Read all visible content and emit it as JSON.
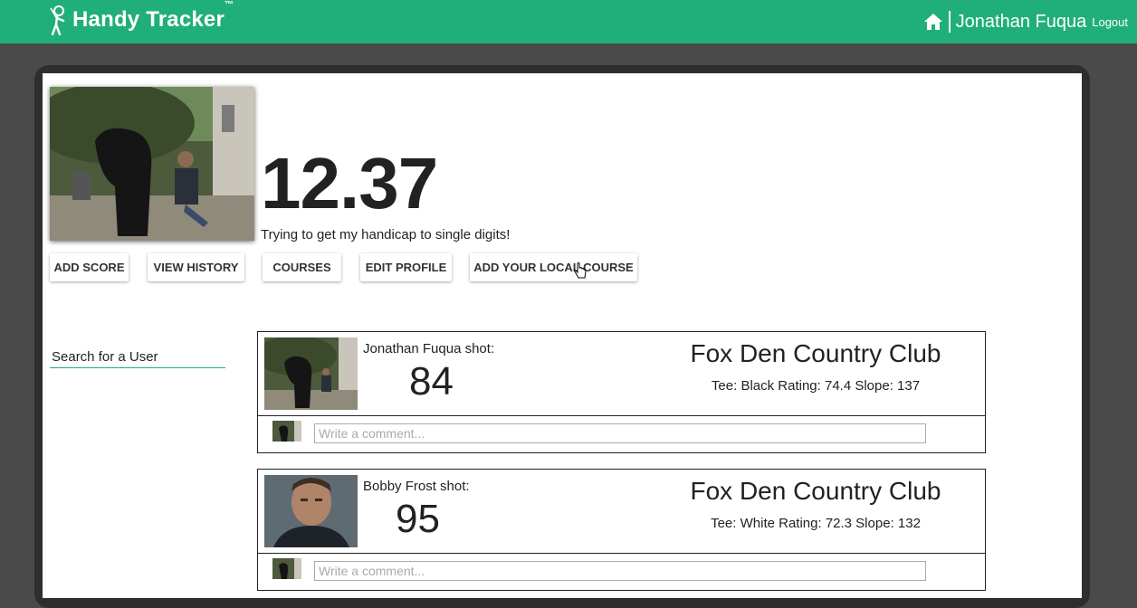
{
  "navbar": {
    "brand": "Handy Tracker",
    "brand_tm": "™",
    "user_name": "Jonathan Fuqua",
    "logout": "Logout",
    "home_icon": "home-icon",
    "logo_icon": "golfer-icon"
  },
  "profile": {
    "handicap": "12.37",
    "bio": "Trying to get my handicap to single digits!"
  },
  "buttons": {
    "add_score": "ADD SCORE",
    "view_history": "VIEW HISTORY",
    "courses": "COURSES",
    "edit_profile": "EDIT PROFILE",
    "add_course": "ADD YOUR LOCAL COURSE"
  },
  "search": {
    "placeholder": "Search for a User"
  },
  "feed": [
    {
      "shot_label": "Jonathan Fuqua shot:",
      "score": "84",
      "course": "Fox Den Country Club",
      "tee_info": "Tee: Black Rating: 74.4 Slope: 137",
      "comment_placeholder": "Write a comment..."
    },
    {
      "shot_label": "Bobby Frost shot:",
      "score": "95",
      "course": "Fox Den Country Club",
      "tee_info": "Tee: White Rating: 72.3 Slope: 132",
      "comment_placeholder": "Write a comment..."
    }
  ],
  "colors": {
    "brand_green": "#20af7a",
    "background": "#4a4a4a"
  }
}
